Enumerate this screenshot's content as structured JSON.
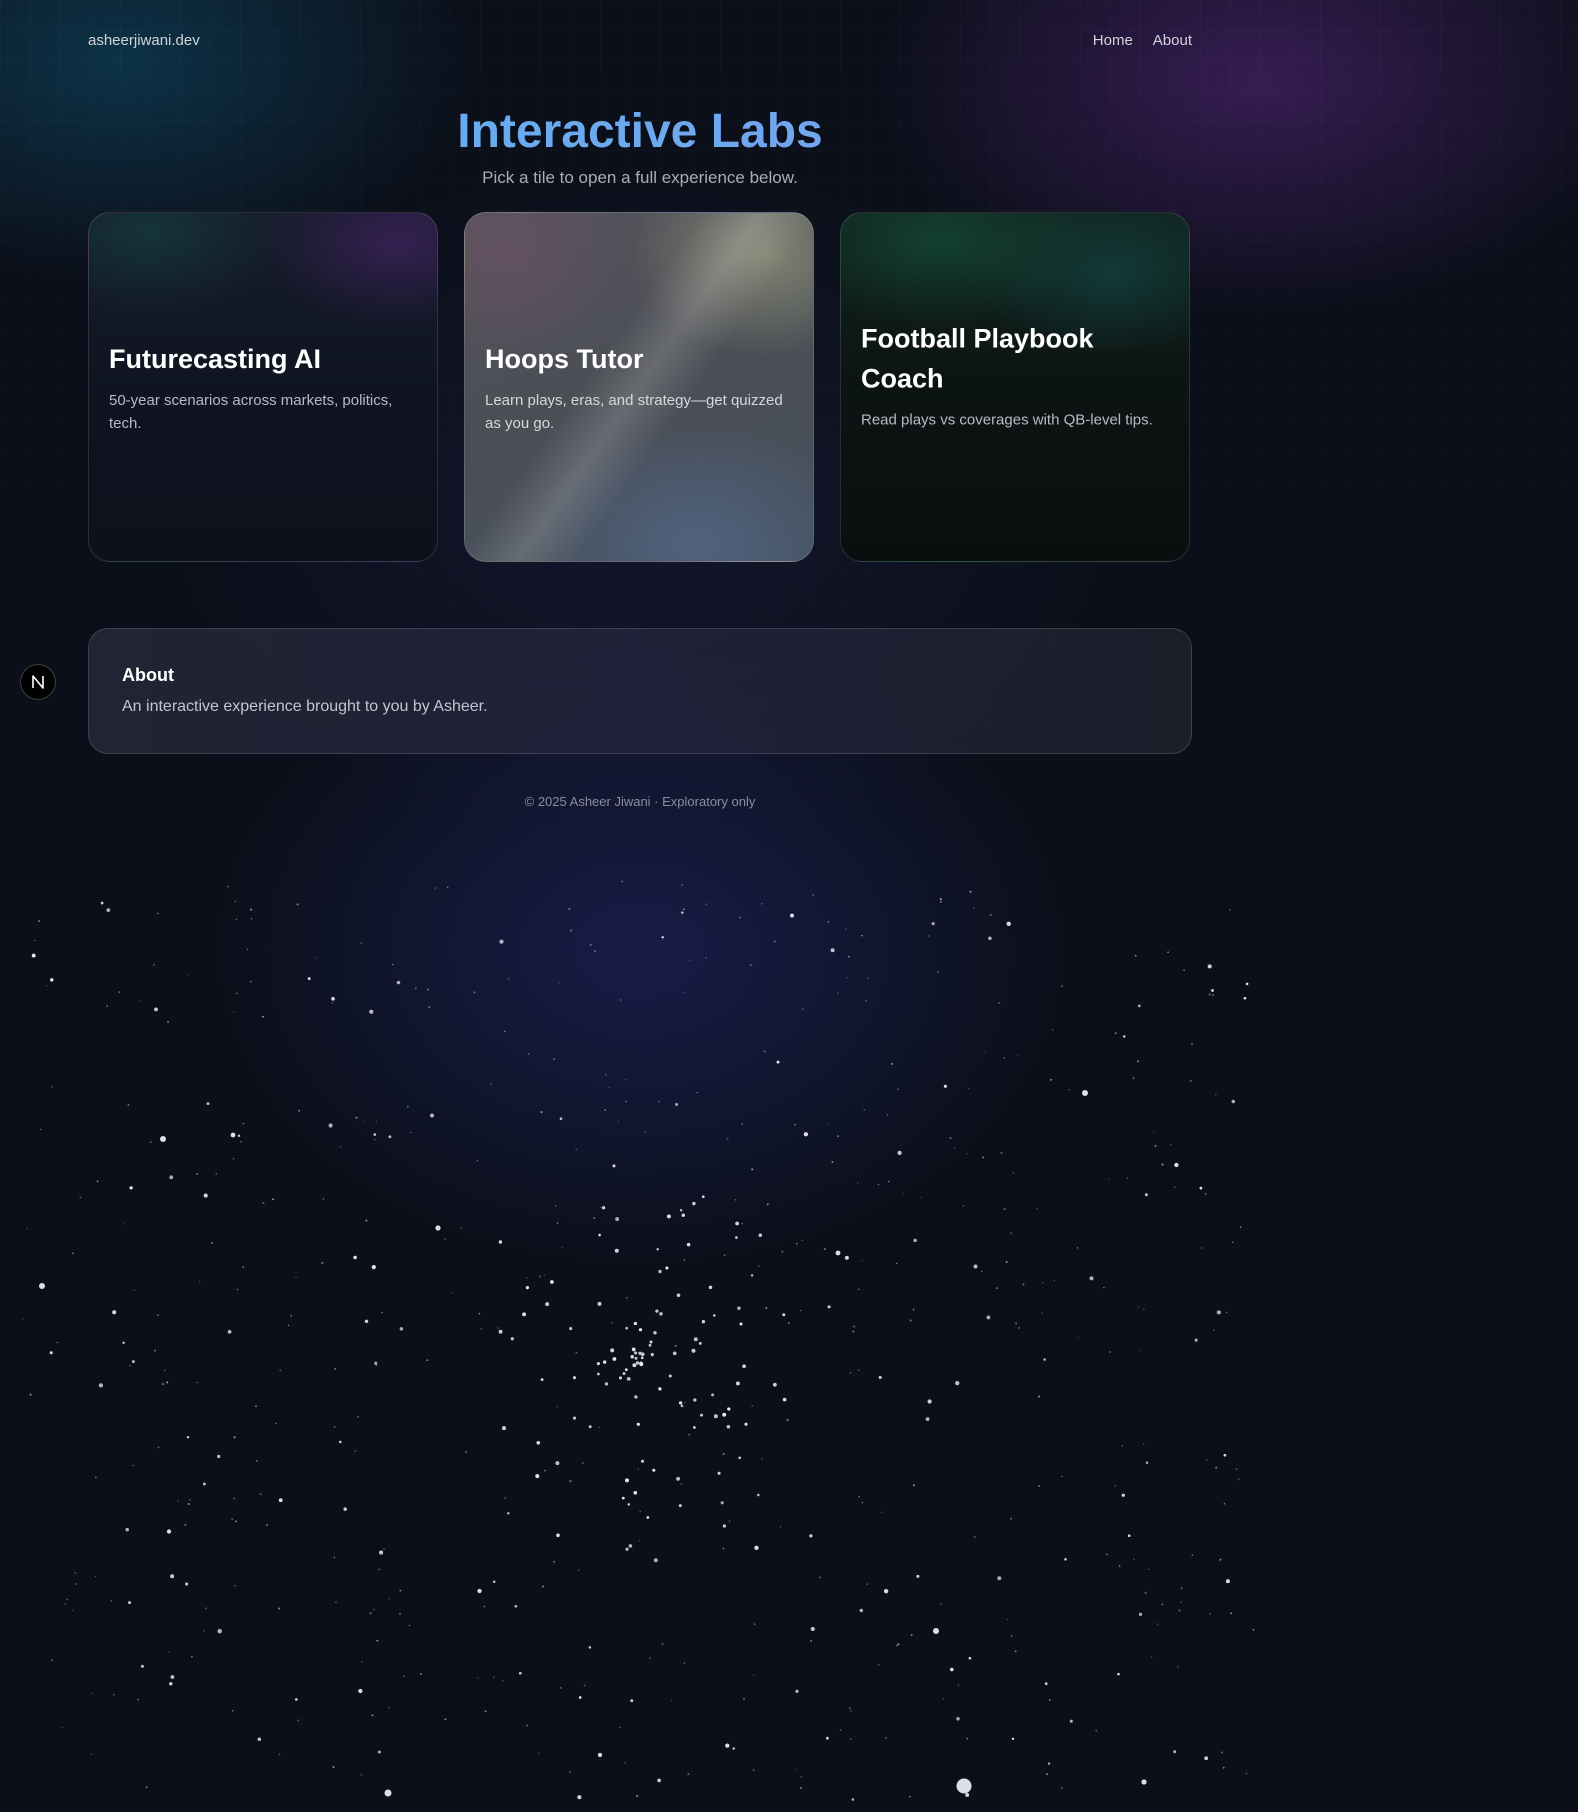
{
  "header": {
    "brand": "asheerjiwani.dev",
    "nav": [
      "Home",
      "About"
    ]
  },
  "hero": {
    "title": "Interactive Labs",
    "subtitle": "Pick a tile to open a full experience below."
  },
  "tiles": [
    {
      "title": "Futurecasting AI",
      "description": "50-year scenarios across markets, politics, tech."
    },
    {
      "title": "Hoops Tutor",
      "description": "Learn plays, eras, and strategy—get quizzed as you go."
    },
    {
      "title": "Football Playbook Coach",
      "description": "Read plays vs coverages with QB-level tips."
    }
  ],
  "about": {
    "heading": "About",
    "text": "An interactive experience brought to you by Asheer."
  },
  "footer": {
    "text": "© 2025 Asheer Jiwani · Exploratory only"
  },
  "badge": {
    "icon": "n-logo-icon"
  },
  "colors": {
    "background": "#0b0f19",
    "title_gradient_start": "#5eb2ee",
    "title_gradient_end": "#7c9ff0",
    "star": "#e8ebf2"
  }
}
